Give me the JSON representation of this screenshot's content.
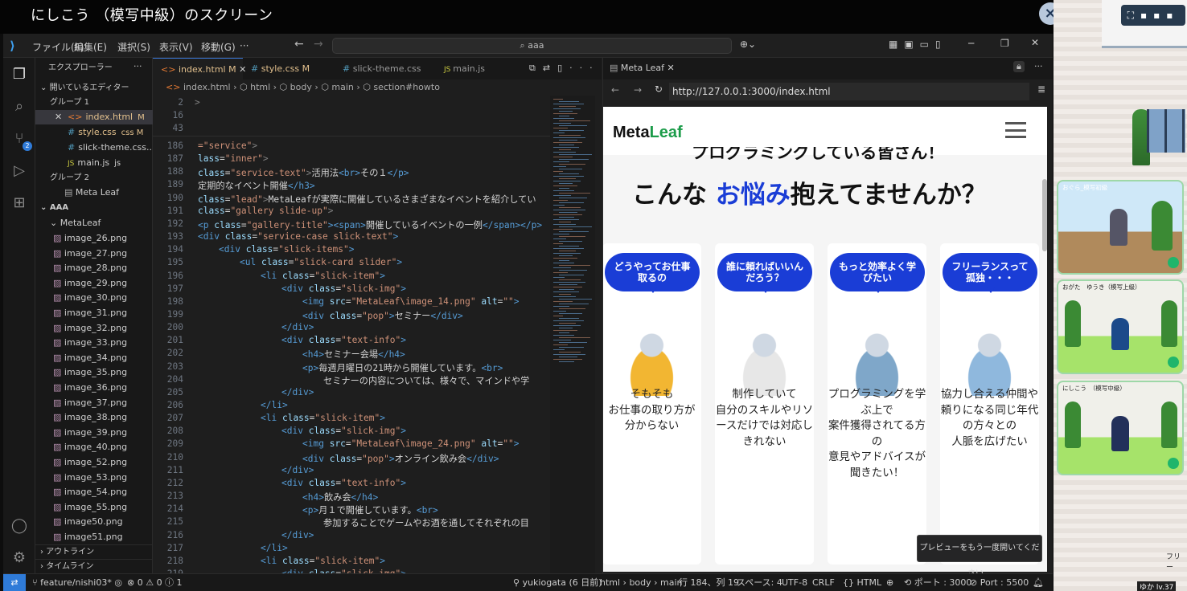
{
  "window": {
    "title": "にしこう （模写中級）のスクリーン",
    "close": "×"
  },
  "menu": {
    "items": [
      "ファイル(F)",
      "編集(E)",
      "選択(S)",
      "表示(V)",
      "移動(G)",
      "···"
    ],
    "search": "aaa"
  },
  "explorer": {
    "title": "エクスプローラー",
    "open_editors": "開いているエディター",
    "group1": "グループ 1",
    "g1_files": [
      {
        "name": "index.html",
        "badge": "M",
        "icon": "<>"
      },
      {
        "name": "style.css",
        "badge": "css  M",
        "icon": "#"
      },
      {
        "name": "slick-theme.css...",
        "badge": "",
        "icon": "#"
      },
      {
        "name": "main.js",
        "badge": "js",
        "icon": "JS"
      }
    ],
    "group2": "グループ 2",
    "g2_files": [
      "Meta Leaf"
    ],
    "folder": "AAA",
    "subfolder": "MetaLeaf",
    "images": [
      "image_26.png",
      "image_27.png",
      "image_28.png",
      "image_29.png",
      "image_30.png",
      "image_31.png",
      "image_32.png",
      "image_33.png",
      "image_34.png",
      "image_35.png",
      "image_36.png",
      "image_37.png",
      "image_38.png",
      "image_39.png",
      "image_40.png",
      "image_52.png",
      "image_53.png",
      "image_54.png",
      "image_55.png",
      "image50.png",
      "image51.png"
    ],
    "outline": "アウトライン",
    "timeline": "タイムライン"
  },
  "tabs": [
    {
      "label": "index.html",
      "mod": "M",
      "active": true
    },
    {
      "label": "style.css",
      "mod": "M"
    },
    {
      "label": "slick-theme.css"
    },
    {
      "label": "main.js"
    }
  ],
  "breadcrumb": [
    "index.html",
    "html",
    "body",
    "main",
    "section#howto"
  ],
  "sticky_lines": [
    {
      "n": "2",
      "t": ">"
    },
    {
      "n": "16",
      "t": ""
    },
    {
      "n": "43",
      "t": ""
    }
  ],
  "code": [
    {
      "n": "186",
      "i": 0,
      "h": "<span class='st'>=\"service\"</span><span class='gy'>></span>"
    },
    {
      "n": "187",
      "i": 0,
      "h": "<span class='at'>lass</span>=<span class='st'>\"inner\"</span><span class='gy'>></span>"
    },
    {
      "n": "188",
      "i": 0,
      "h": "<span class='at'>class</span>=<span class='st'>\"service-text\"</span><span class='gy'>></span>活用法<span class='kw'>&lt;br&gt;</span>その１<span class='kw'>&lt;/p&gt;</span>"
    },
    {
      "n": "189",
      "i": 0,
      "h": "定期的なイベント開催<span class='kw'>&lt;/h3&gt;</span>"
    },
    {
      "n": "190",
      "i": 0,
      "h": "<span class='at'>class</span>=<span class='st'>\"lead\"</span><span class='gy'>></span>MetaLeafが実際に開催しているさまざまなイベントを紹介してい"
    },
    {
      "n": "191",
      "i": 0,
      "h": "<span class='at'>class</span>=<span class='st'>\"gallery slide-up\"</span><span class='gy'>></span>"
    },
    {
      "n": "192",
      "i": 0,
      "h": "<span class='kw'>&lt;p</span> <span class='at'>class</span>=<span class='st'>\"gallery-title\"</span><span class='kw'>&gt;&lt;span&gt;</span>開催しているイベントの一例<span class='kw'>&lt;/span&gt;&lt;/p&gt;</span>"
    },
    {
      "n": "193",
      "i": 0,
      "h": "<span class='kw'>&lt;div</span> <span class='at'>class</span>=<span class='st'>\"service-case slick-text\"</span><span class='kw'>&gt;</span>"
    },
    {
      "n": "194",
      "i": 1,
      "h": "<span class='kw'>&lt;div</span> <span class='at'>class</span>=<span class='st'>\"slick-items\"</span><span class='kw'>&gt;</span>"
    },
    {
      "n": "195",
      "i": 2,
      "h": "<span class='kw'>&lt;ul</span> <span class='at'>class</span>=<span class='st'>\"slick-card slider\"</span><span class='kw'>&gt;</span>"
    },
    {
      "n": "196",
      "i": 3,
      "h": "<span class='kw'>&lt;li</span> <span class='at'>class</span>=<span class='st'>\"slick-item\"</span><span class='kw'>&gt;</span>"
    },
    {
      "n": "197",
      "i": 4,
      "h": "<span class='kw'>&lt;div</span> <span class='at'>class</span>=<span class='st'>\"slick-img\"</span><span class='kw'>&gt;</span>"
    },
    {
      "n": "198",
      "i": 5,
      "h": "<span class='kw'>&lt;img</span> <span class='at'>src</span>=<span class='st'>\"MetaLeaf\\image_14.png\"</span> <span class='at'>alt</span>=<span class='st'>\"\"</span><span class='kw'>&gt;</span>"
    },
    {
      "n": "199",
      "i": 5,
      "h": "<span class='kw'>&lt;div</span> <span class='at'>class</span>=<span class='st'>\"pop\"</span><span class='kw'>&gt;</span>セミナー<span class='kw'>&lt;/div&gt;</span>"
    },
    {
      "n": "200",
      "i": 4,
      "h": "<span class='kw'>&lt;/div&gt;</span>"
    },
    {
      "n": "201",
      "i": 4,
      "h": "<span class='kw'>&lt;div</span> <span class='at'>class</span>=<span class='st'>\"text-info\"</span><span class='kw'>&gt;</span>"
    },
    {
      "n": "202",
      "i": 5,
      "h": "<span class='kw'>&lt;h4&gt;</span>セミナー会場<span class='kw'>&lt;/h4&gt;</span>"
    },
    {
      "n": "203",
      "i": 5,
      "h": "<span class='kw'>&lt;p&gt;</span>毎週月曜日の21時から開催しています。<span class='kw'>&lt;br&gt;</span>"
    },
    {
      "n": "204",
      "i": 6,
      "h": "セミナーの内容については、様々で、マインドや学"
    },
    {
      "n": "205",
      "i": 4,
      "h": "<span class='kw'>&lt;/div&gt;</span>"
    },
    {
      "n": "206",
      "i": 3,
      "h": "<span class='kw'>&lt;/li&gt;</span>"
    },
    {
      "n": "207",
      "i": 3,
      "h": "<span class='kw'>&lt;li</span> <span class='at'>class</span>=<span class='st'>\"slick-item\"</span><span class='kw'>&gt;</span>"
    },
    {
      "n": "208",
      "i": 4,
      "h": "<span class='kw'>&lt;div</span> <span class='at'>class</span>=<span class='st'>\"slick-img\"</span><span class='kw'>&gt;</span>"
    },
    {
      "n": "209",
      "i": 5,
      "h": "<span class='kw'>&lt;img</span> <span class='at'>src</span>=<span class='st'>\"MetaLeaf\\image_24.png\"</span> <span class='at'>alt</span>=<span class='st'>\"\"</span><span class='kw'>&gt;</span>"
    },
    {
      "n": "210",
      "i": 5,
      "h": "<span class='kw'>&lt;div</span> <span class='at'>class</span>=<span class='st'>\"pop\"</span><span class='kw'>&gt;</span>オンライン飲み会<span class='kw'>&lt;/div&gt;</span>"
    },
    {
      "n": "211",
      "i": 4,
      "h": "<span class='kw'>&lt;/div&gt;</span>"
    },
    {
      "n": "212",
      "i": 4,
      "h": "<span class='kw'>&lt;div</span> <span class='at'>class</span>=<span class='st'>\"text-info\"</span><span class='kw'>&gt;</span>"
    },
    {
      "n": "213",
      "i": 5,
      "h": "<span class='kw'>&lt;h4&gt;</span>飲み会<span class='kw'>&lt;/h4&gt;</span>"
    },
    {
      "n": "214",
      "i": 5,
      "h": "<span class='kw'>&lt;p&gt;</span>月１で開催しています。<span class='kw'>&lt;br&gt;</span>"
    },
    {
      "n": "215",
      "i": 6,
      "h": "参加することでゲームやお酒を通してそれぞれの目"
    },
    {
      "n": "216",
      "i": 4,
      "h": "<span class='kw'>&lt;/div&gt;</span>"
    },
    {
      "n": "217",
      "i": 3,
      "h": "<span class='kw'>&lt;/li&gt;</span>"
    },
    {
      "n": "218",
      "i": 3,
      "h": "<span class='kw'>&lt;li</span> <span class='at'>class</span>=<span class='st'>\"slick-item\"</span><span class='kw'>&gt;</span>"
    },
    {
      "n": "219",
      "i": 4,
      "h": "<span class='kw'>&lt;div</span> <span class='at'>class</span>=<span class='st'>\"slick-img\"</span><span class='kw'>&gt;</span>"
    }
  ],
  "preview": {
    "tab": "Meta Leaf",
    "url": "http://127.0.0.1:3000/index.html",
    "logo_a": "Meta",
    "logo_b": "Leaf",
    "cut_heading": "プログラミングしている皆さん！",
    "heading_a": "こんな ",
    "heading_b": "お悩み",
    "heading_c": "抱えてませんか？",
    "cards": [
      {
        "bubble": "どうやってお仕事\n取るの",
        "text": "そもそも\nお仕事の取り方が\n分からない"
      },
      {
        "bubble": "誰に頼ればいいん\nだろう？",
        "text": "制作していて\n自分のスキルやリソ\nースだけでは対応し\nきれない"
      },
      {
        "bubble": "もっと効率よく学\nびたい",
        "text": "プログラミングを学\nぶ上で\n案件獲得されてる方\nの\n意見やアドバイスが\n聞きたい！"
      },
      {
        "bubble": "フリーランスって\n孤独・・・",
        "text": "協力し合える仲間や\n頼りになる同じ年代\nの方々との\n人脈を広げたい"
      }
    ],
    "toast": "プレビューをもう一度開いてください。"
  },
  "status": {
    "branch": "feature/nishi03*",
    "errors": "⊗ 0 ⚠ 0 ⓘ 1",
    "author": "yukiogata (6 日前)",
    "crumb": "html › body › main",
    "pos": "行 184、列 19",
    "spaces": "スペース: 4",
    "enc": "UTF-8",
    "eol": "CRLF",
    "lang": "{} HTML",
    "port": "ポート : 3000",
    "port2": "Port : 5500"
  },
  "game": {
    "v1": "おぐら_模写初級",
    "v2": "おがた　ゆうき（模写上級）",
    "v3": "にしこう　（模写中級）",
    "bottom": "ゆか lv.37",
    "side": "フリー"
  }
}
